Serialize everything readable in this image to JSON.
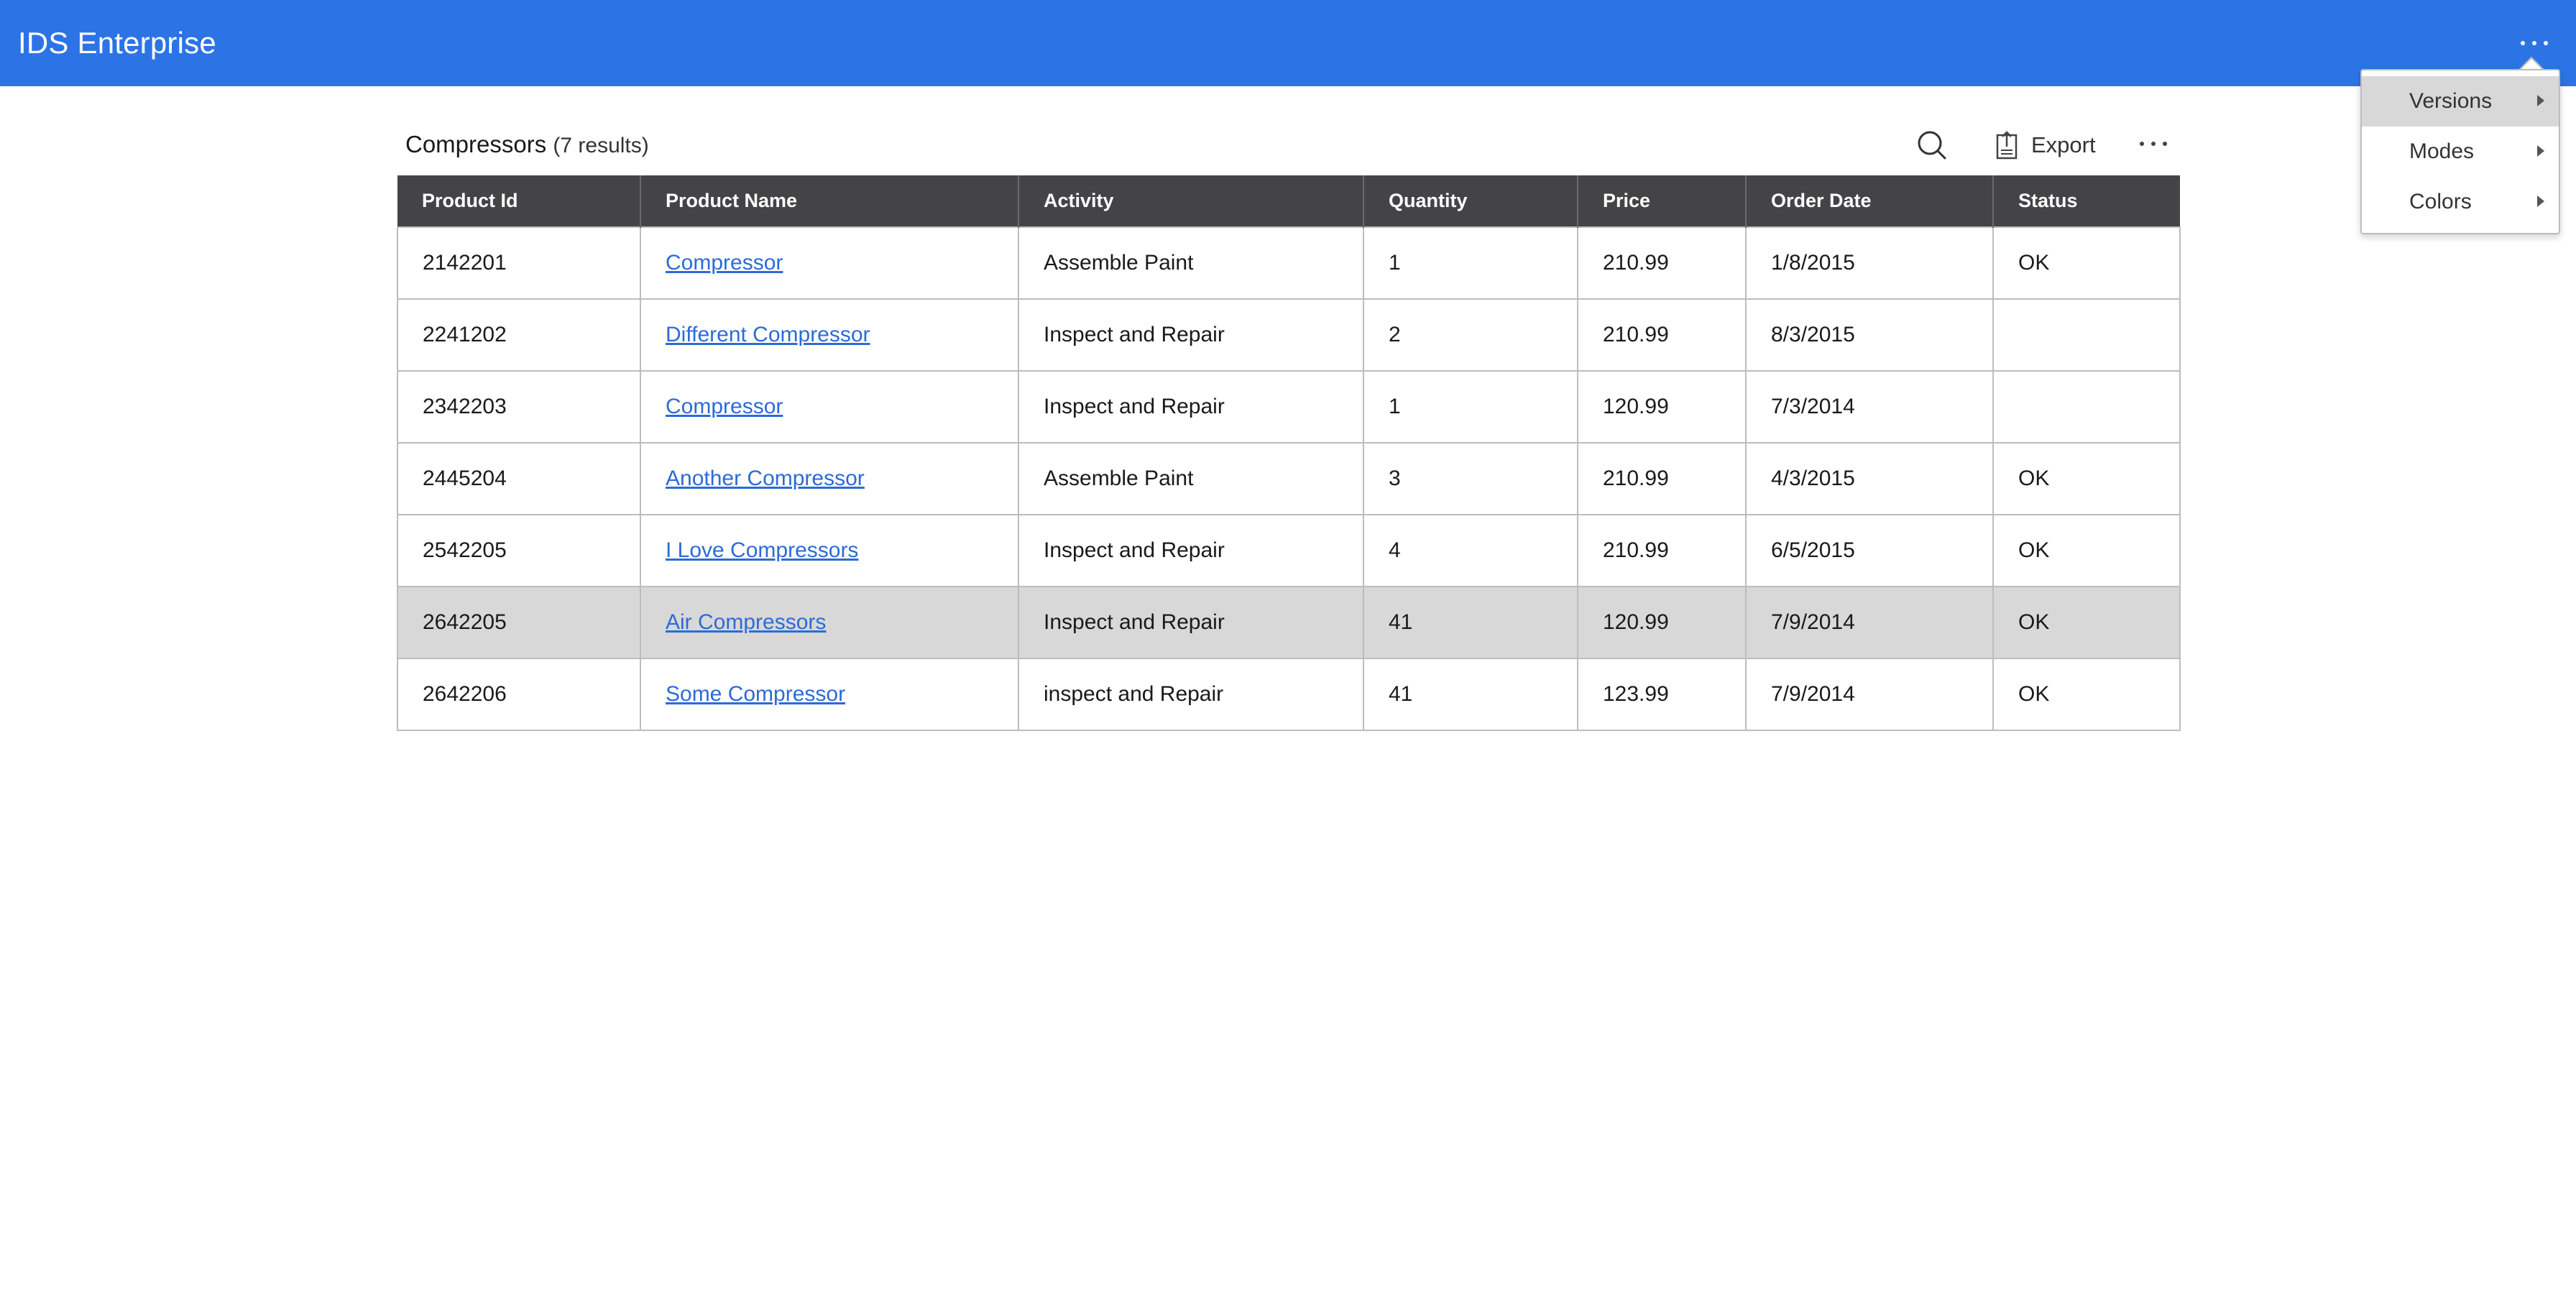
{
  "header": {
    "title": "IDS Enterprise",
    "more_icon": "more-horizontal-icon",
    "color": "#2c74e6"
  },
  "toolbar": {
    "title": "Compressors",
    "result_count": "(7 results)",
    "search_icon": "search-icon",
    "export_label": "Export",
    "export_icon": "export-icon",
    "more_icon": "more-horizontal-icon"
  },
  "grid": {
    "columns": [
      "Product Id",
      "Product Name",
      "Activity",
      "Quantity",
      "Price",
      "Order Date",
      "Status"
    ],
    "rows": [
      {
        "id": "2142201",
        "name": "Compressor",
        "activity": "Assemble Paint",
        "quantity": "1",
        "price": "210.99",
        "date": "1/8/2015",
        "status": "OK"
      },
      {
        "id": "2241202",
        "name": "Different Compressor",
        "activity": "Inspect and Repair",
        "quantity": "2",
        "price": "210.99",
        "date": "8/3/2015",
        "status": ""
      },
      {
        "id": "2342203",
        "name": "Compressor",
        "activity": "Inspect and Repair",
        "quantity": "1",
        "price": "120.99",
        "date": "7/3/2014",
        "status": ""
      },
      {
        "id": "2445204",
        "name": "Another Compressor",
        "activity": "Assemble Paint",
        "quantity": "3",
        "price": "210.99",
        "date": "4/3/2015",
        "status": "OK"
      },
      {
        "id": "2542205",
        "name": "I Love Compressors",
        "activity": "Inspect and Repair",
        "quantity": "4",
        "price": "210.99",
        "date": "6/5/2015",
        "status": "OK"
      },
      {
        "id": "2642205",
        "name": "Air Compressors",
        "activity": "Inspect and Repair",
        "quantity": "41",
        "price": "120.99",
        "date": "7/9/2014",
        "status": "OK"
      },
      {
        "id": "2642206",
        "name": "Some Compressor",
        "activity": "inspect and Repair",
        "quantity": "41",
        "price": "123.99",
        "date": "7/9/2014",
        "status": "OK"
      }
    ],
    "header_color": "#444446",
    "link_color": "#2c6bd6",
    "selected_row_color": "#d8d8d8"
  },
  "menu": {
    "items": [
      {
        "label": "Versions",
        "active": true
      },
      {
        "label": "Modes",
        "active": false
      },
      {
        "label": "Colors",
        "active": false
      }
    ]
  }
}
